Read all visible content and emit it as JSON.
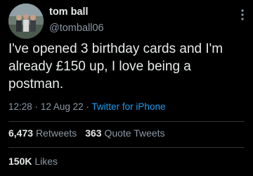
{
  "user": {
    "name": "tom ball",
    "handle": "@tomball06",
    "avatar": "profile-photo"
  },
  "tweet": {
    "text": "I've opened 3 birthday cards and I'm already £150 up, I love being a postman."
  },
  "meta": {
    "time": "12:28",
    "separator1": "·",
    "date": "12 Aug 22",
    "separator2": "·",
    "source": "Twitter for iPhone"
  },
  "stats": {
    "retweets_count": "6,473",
    "retweets_label": "Retweets",
    "quotes_count": "363",
    "quotes_label": "Quote Tweets",
    "likes_count": "150K",
    "likes_label": "Likes"
  },
  "colors": {
    "background": "#000000",
    "text": "#e7e9ea",
    "secondary": "#8b98a5",
    "link": "#1d9bf0",
    "divider": "#2f3336"
  },
  "icons": {
    "more": "more-options-icon"
  }
}
